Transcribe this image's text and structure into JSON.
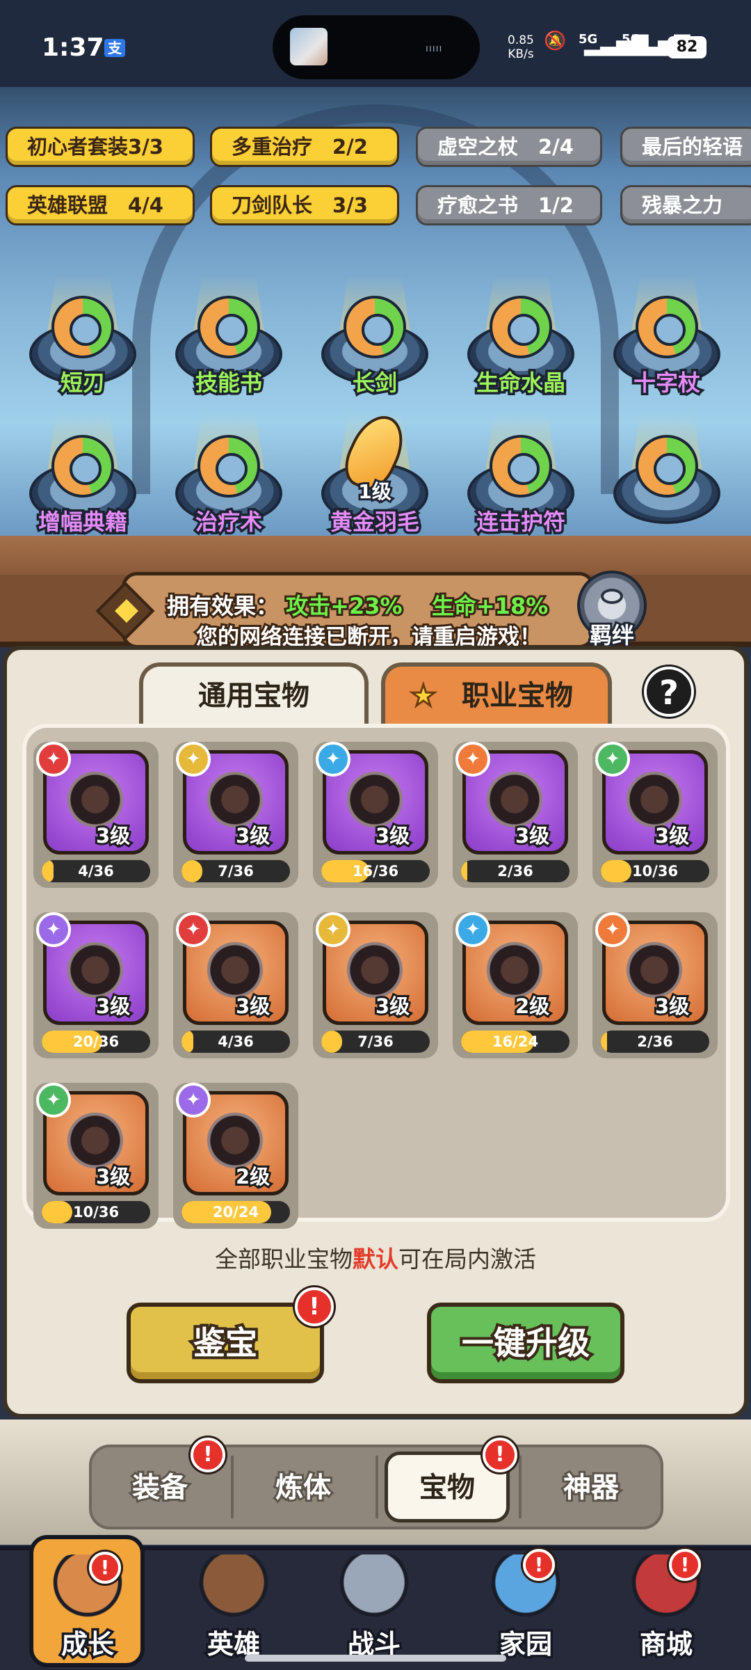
{
  "status_bar": {
    "time": "1:37",
    "alipay_icon": "alipay-icon",
    "net_speed_value": "0.85",
    "net_speed_unit": "KB/s",
    "mute_icon": "mute-icon",
    "signal_1": "5G",
    "signal_2": "5G",
    "battery": "82"
  },
  "sets": [
    {
      "label": "初心者套装3/3",
      "active": true
    },
    {
      "label": "多重治疗　2/2",
      "active": true
    },
    {
      "label": "虚空之杖　2/4",
      "active": false
    },
    {
      "label": "最后的轻语",
      "active": false
    },
    {
      "label": "英雄联盟　4/4",
      "active": true
    },
    {
      "label": "刀剑队长　3/3",
      "active": true
    },
    {
      "label": "疗愈之书　1/2",
      "active": false
    },
    {
      "label": "残暴之力",
      "active": false
    }
  ],
  "slots": [
    {
      "label": "短刃",
      "color": "green"
    },
    {
      "label": "技能书",
      "color": "green"
    },
    {
      "label": "长剑",
      "color": "green"
    },
    {
      "label": "生命水晶",
      "color": "green"
    },
    {
      "label": "十字杖",
      "color": "purple"
    },
    {
      "label": "增幅典籍",
      "color": "purple"
    },
    {
      "label": "治疗术",
      "color": "purple"
    },
    {
      "label": "黄金羽毛",
      "color": "purple",
      "level": "1级"
    },
    {
      "label": "连击护符",
      "color": "purple"
    },
    {
      "label": "",
      "color": "purple"
    }
  ],
  "effect": {
    "label": "拥有效果：",
    "attack": "攻击+23%",
    "life": "生命+18%",
    "disconnect": "您的网络连接已断开，请重启游戏！",
    "bond_label": "羁绊"
  },
  "tabs": {
    "general": "通用宝物",
    "job": "职业宝物",
    "help": "?"
  },
  "treasures": [
    {
      "level": "3级",
      "progress": "4/36",
      "fill": 0.11,
      "frame": "purple",
      "badge_color": "#e23d3d",
      "badge_icon": "sword-icon"
    },
    {
      "level": "3级",
      "progress": "7/36",
      "fill": 0.19,
      "frame": "purple",
      "badge_color": "#e6b93a",
      "badge_icon": "bow-icon"
    },
    {
      "level": "3级",
      "progress": "16/36",
      "fill": 0.44,
      "frame": "purple",
      "badge_color": "#3aa9e6",
      "badge_icon": "staff-icon"
    },
    {
      "level": "3级",
      "progress": "2/36",
      "fill": 0.06,
      "frame": "purple",
      "badge_color": "#f07a3a",
      "badge_icon": "fist-icon"
    },
    {
      "level": "3级",
      "progress": "10/36",
      "fill": 0.28,
      "frame": "purple",
      "badge_color": "#4cb862",
      "badge_icon": "lotus-icon"
    },
    {
      "level": "3级",
      "progress": "20/36",
      "fill": 0.56,
      "frame": "purple",
      "badge_color": "#9b6ae8",
      "badge_icon": "gun-icon"
    },
    {
      "level": "3级",
      "progress": "4/36",
      "fill": 0.11,
      "frame": "orange",
      "badge_color": "#e23d3d",
      "badge_icon": "sword-icon"
    },
    {
      "level": "3级",
      "progress": "7/36",
      "fill": 0.19,
      "frame": "orange",
      "badge_color": "#e6b93a",
      "badge_icon": "bow-icon"
    },
    {
      "level": "2级",
      "progress": "16/24",
      "fill": 0.67,
      "frame": "orange",
      "badge_color": "#3aa9e6",
      "badge_icon": "staff-icon"
    },
    {
      "level": "3级",
      "progress": "2/36",
      "fill": 0.06,
      "frame": "orange",
      "badge_color": "#f07a3a",
      "badge_icon": "fist-icon"
    },
    {
      "level": "3级",
      "progress": "10/36",
      "fill": 0.28,
      "frame": "orange",
      "badge_color": "#4cb862",
      "badge_icon": "lotus-icon"
    },
    {
      "level": "2级",
      "progress": "20/24",
      "fill": 0.83,
      "frame": "orange",
      "badge_color": "#9b6ae8",
      "badge_icon": "gun-icon"
    }
  ],
  "note": {
    "prefix": "全部职业宝物",
    "highlight": "默认",
    "suffix": "可在局内激活"
  },
  "buttons": {
    "appraise": "鉴宝",
    "upgrade": "一键升级",
    "alert": "!"
  },
  "subtabs": [
    "装备",
    "炼体",
    "宝物",
    "神器"
  ],
  "bottom_nav": [
    {
      "label": "成长",
      "icon": "fist-armor-icon"
    },
    {
      "label": "英雄",
      "icon": "hero-portrait-icon"
    },
    {
      "label": "战斗",
      "icon": "swords-icon"
    },
    {
      "label": "家园",
      "icon": "crystal-house-icon"
    },
    {
      "label": "商城",
      "icon": "coin-cart-icon"
    }
  ]
}
